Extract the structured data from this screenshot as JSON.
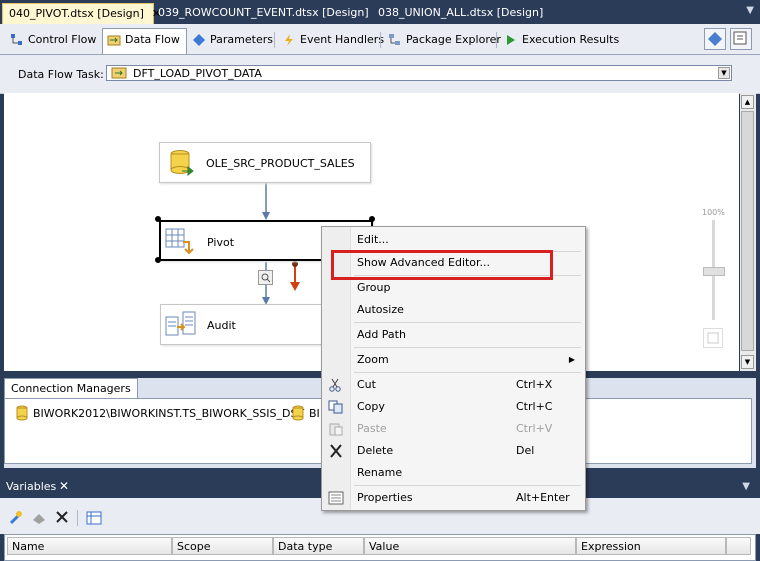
{
  "doc_tabs": [
    {
      "label": "040_PIVOT.dtsx [Design]",
      "close": "✕"
    },
    {
      "label": "039_ROWCOUNT_EVENT.dtsx [Design]"
    },
    {
      "label": "038_UNION_ALL.dtsx [Design]"
    }
  ],
  "designer_tabs": [
    {
      "label": "Control Flow",
      "icon": "control-flow-icon"
    },
    {
      "label": "Data Flow",
      "icon": "data-flow-icon"
    },
    {
      "label": "Parameters",
      "icon": "parameters-icon"
    },
    {
      "label": "Event Handlers",
      "icon": "event-handlers-icon"
    },
    {
      "label": "Package Explorer",
      "icon": "package-explorer-icon"
    },
    {
      "label": "Execution Results",
      "icon": "execution-results-icon"
    }
  ],
  "task": {
    "label": "Data Flow Task:",
    "value": "DFT_LOAD_PIVOT_DATA"
  },
  "nodes": {
    "source": "OLE_SRC_PRODUCT_SALES",
    "pivot": "Pivot",
    "audit": "Audit"
  },
  "zoom": {
    "label": "100%"
  },
  "connection_managers": {
    "tab": "Connection Managers",
    "items": [
      "BIWORK2012\\BIWORKINST.TS_BIWORK_SSIS_DST",
      "BI"
    ]
  },
  "variables": {
    "title": "Variables",
    "close": "✕",
    "columns": [
      "Name",
      "Scope",
      "Data type",
      "Value",
      "Expression"
    ]
  },
  "context_menu": {
    "items": [
      {
        "label": "Edit..."
      },
      {
        "label": "Show Advanced Editor..."
      },
      {
        "label": "Group"
      },
      {
        "label": "Autosize"
      },
      {
        "label": "Add Path"
      },
      {
        "label": "Zoom",
        "submenu": "▶"
      },
      {
        "label": "Cut",
        "shortcut": "Ctrl+X",
        "icon": "scissors-icon"
      },
      {
        "label": "Copy",
        "shortcut": "Ctrl+C",
        "icon": "copy-icon"
      },
      {
        "label": "Paste",
        "shortcut": "Ctrl+V",
        "icon": "paste-icon",
        "disabled": true
      },
      {
        "label": "Delete",
        "shortcut": "Del",
        "icon": "delete-icon"
      },
      {
        "label": "Rename"
      },
      {
        "label": "Properties",
        "shortcut": "Alt+Enter",
        "icon": "properties-icon"
      }
    ]
  },
  "colors": {
    "chrome": "#2b3c59",
    "active_tab": "#fff7d1",
    "highlight": "#d92020"
  }
}
